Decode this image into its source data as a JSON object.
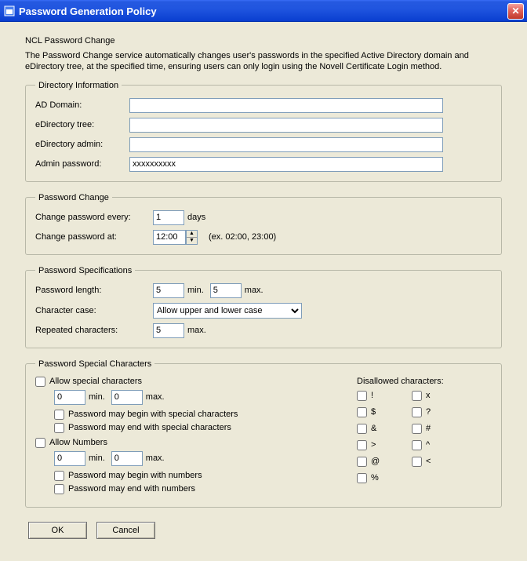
{
  "window": {
    "title": "Password Generation Policy"
  },
  "heading": "NCL Password Change",
  "description": "The Password Change service automatically changes user's passwords in the specified Active Directory domain and eDirectory tree, at the specified time, ensuring users can only login using the Novell Certificate Login method.",
  "directory": {
    "legend": "Directory Information",
    "ad_domain_label": "AD Domain:",
    "ad_domain_value": "",
    "edir_tree_label": "eDirectory tree:",
    "edir_tree_value": "",
    "edir_admin_label": "eDirectory admin:",
    "edir_admin_value": "",
    "admin_pw_label": "Admin password:",
    "admin_pw_value": "xxxxxxxxxx"
  },
  "change": {
    "legend": "Password Change",
    "every_label": "Change password every:",
    "every_value": "1",
    "every_unit": "days",
    "at_label": "Change password at:",
    "at_value": "12:00",
    "at_hint": "(ex. 02:00, 23:00)"
  },
  "spec": {
    "legend": "Password Specifications",
    "length_label": "Password length:",
    "length_min": "5",
    "length_max": "5",
    "min_lbl": "min.",
    "max_lbl": "max.",
    "case_label": "Character case:",
    "case_selected": "Allow upper and lower case",
    "repeat_label": "Repeated characters:",
    "repeat_value": "5"
  },
  "special": {
    "legend": "Password Special Characters",
    "allow_special_label": "Allow special characters",
    "sp_min": "0",
    "sp_max": "0",
    "sp_begin_label": "Password may begin with special characters",
    "sp_end_label": "Password may end with special characters",
    "allow_numbers_label": "Allow Numbers",
    "num_min": "0",
    "num_max": "0",
    "num_begin_label": "Password may begin with numbers",
    "num_end_label": "Password may end with numbers",
    "disallowed_label": "Disallowed characters:",
    "chars": [
      "!",
      "x",
      "$",
      "?",
      "&",
      "#",
      ">",
      "^",
      "@",
      "<",
      "%"
    ],
    "min_lbl": "min.",
    "max_lbl": "max."
  },
  "buttons": {
    "ok": "OK",
    "cancel": "Cancel"
  }
}
